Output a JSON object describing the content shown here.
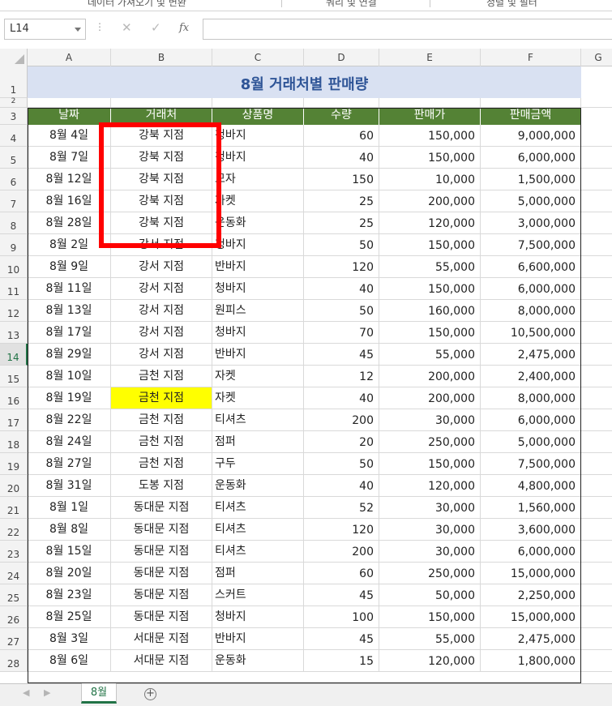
{
  "ribbon": {
    "groups": [
      "데이터 가져오기 및 변환",
      "쿼리 및 연결",
      "정렬 및 필터"
    ]
  },
  "formula_bar": {
    "name_box": "L14",
    "cancel_icon": "✕",
    "enter_icon": "✓",
    "fx_label": "fx",
    "formula": ""
  },
  "columns": [
    "A",
    "B",
    "C",
    "D",
    "E",
    "F",
    "G"
  ],
  "row_numbers": [
    "1",
    "2",
    "3",
    "4",
    "5",
    "6",
    "7",
    "8",
    "9",
    "10",
    "11",
    "12",
    "13",
    "14",
    "15",
    "16",
    "17",
    "18",
    "19",
    "20",
    "21",
    "22",
    "23",
    "24",
    "25",
    "26",
    "27",
    "28"
  ],
  "sheet": {
    "title": "8월 거래처별 판매량",
    "headers": [
      "날짜",
      "거래처",
      "상품명",
      "수량",
      "판매가",
      "판매금액"
    ],
    "rows": [
      [
        "8월 4일",
        "강북 지점",
        "청바지",
        "60",
        "150,000",
        "9,000,000"
      ],
      [
        "8월 7일",
        "강북 지점",
        "청바지",
        "40",
        "150,000",
        "6,000,000"
      ],
      [
        "8월 12일",
        "강북 지점",
        "모자",
        "150",
        "10,000",
        "1,500,000"
      ],
      [
        "8월 16일",
        "강북 지점",
        "자켓",
        "25",
        "200,000",
        "5,000,000"
      ],
      [
        "8월 28일",
        "강북 지점",
        "운동화",
        "25",
        "120,000",
        "3,000,000"
      ],
      [
        "8월 2일",
        "강서 지점",
        "청바지",
        "50",
        "150,000",
        "7,500,000"
      ],
      [
        "8월 9일",
        "강서 지점",
        "반바지",
        "120",
        "55,000",
        "6,600,000"
      ],
      [
        "8월 11일",
        "강서 지점",
        "청바지",
        "40",
        "150,000",
        "6,000,000"
      ],
      [
        "8월 13일",
        "강서 지점",
        "원피스",
        "50",
        "160,000",
        "8,000,000"
      ],
      [
        "8월 17일",
        "강서 지점",
        "청바지",
        "70",
        "150,000",
        "10,500,000"
      ],
      [
        "8월 29일",
        "강서 지점",
        "반바지",
        "45",
        "55,000",
        "2,475,000"
      ],
      [
        "8월 10일",
        "금천 지점",
        "자켓",
        "12",
        "200,000",
        "2,400,000"
      ],
      [
        "8월 19일",
        "금천 지점",
        "자켓",
        "40",
        "200,000",
        "8,000,000"
      ],
      [
        "8월 22일",
        "금천 지점",
        "티셔츠",
        "200",
        "30,000",
        "6,000,000"
      ],
      [
        "8월 24일",
        "금천 지점",
        "점퍼",
        "20",
        "250,000",
        "5,000,000"
      ],
      [
        "8월 27일",
        "금천 지점",
        "구두",
        "50",
        "150,000",
        "7,500,000"
      ],
      [
        "8월 31일",
        "도봉 지점",
        "운동화",
        "40",
        "120,000",
        "4,800,000"
      ],
      [
        "8월 1일",
        "동대문 지점",
        "티셔츠",
        "52",
        "30,000",
        "1,560,000"
      ],
      [
        "8월 8일",
        "동대문 지점",
        "티셔츠",
        "120",
        "30,000",
        "3,600,000"
      ],
      [
        "8월 15일",
        "동대문 지점",
        "티셔츠",
        "200",
        "30,000",
        "6,000,000"
      ],
      [
        "8월 20일",
        "동대문 지점",
        "점퍼",
        "60",
        "250,000",
        "15,000,000"
      ],
      [
        "8월 23일",
        "동대문 지점",
        "스커트",
        "45",
        "50,000",
        "2,250,000"
      ],
      [
        "8월 25일",
        "동대문 지점",
        "청바지",
        "100",
        "150,000",
        "15,000,000"
      ],
      [
        "8월 3일",
        "서대문 지점",
        "반바지",
        "45",
        "55,000",
        "2,475,000"
      ],
      [
        "8월 6일",
        "서대문 지점",
        "운동화",
        "15",
        "120,000",
        "1,800,000"
      ]
    ],
    "highlighted_cell": "B16",
    "highlight_color": "#ffff00",
    "header_fill": "#548235",
    "title_fill": "#d9e1f2",
    "title_color": "#2f5597",
    "annotation_color": "#ff0000"
  },
  "tabs": {
    "active": "8월",
    "nav_prev": "◀",
    "nav_next": "▶",
    "add_icon": "+"
  }
}
